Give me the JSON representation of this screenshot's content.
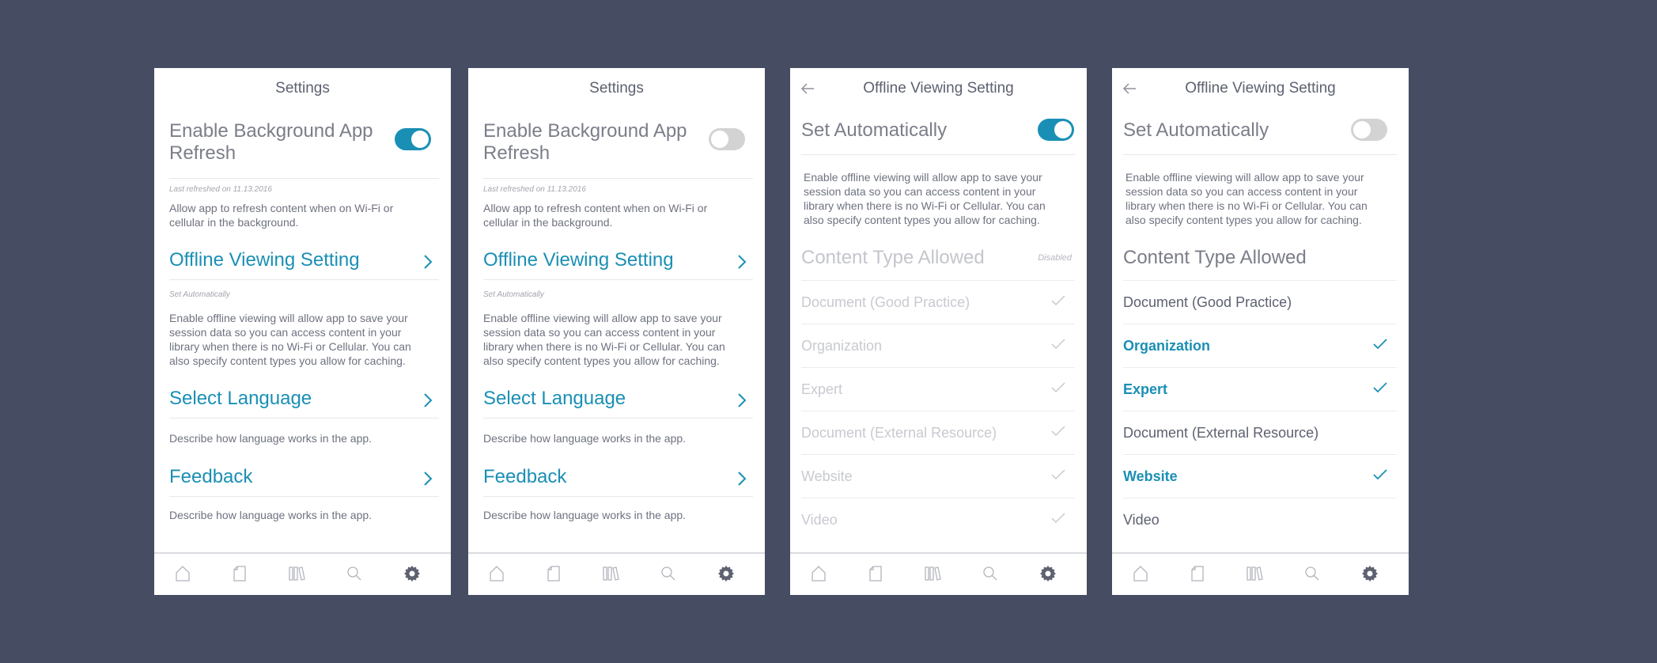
{
  "colors": {
    "background": "#464c61",
    "accent": "#1a8fb5",
    "text": "#7b7e89",
    "muted": "#c8cad0"
  },
  "tabbar": {
    "icons": [
      "home-icon",
      "document-icon",
      "library-icon",
      "search-icon",
      "gear-icon"
    ],
    "active": "gear-icon"
  },
  "screens": [
    {
      "title": "Settings",
      "bg_refresh": {
        "label": "Enable Background App Refresh",
        "enabled": true
      },
      "last_refreshed": "Last refreshed on 11.13.2016",
      "refresh_desc": "Allow app to refresh content when on Wi-Fi or cellular in the background.",
      "offline_link": "Offline Viewing Setting",
      "offline_note": "Set Automatically",
      "offline_desc": "Enable offline viewing will allow app to save your session data so you can access content in your library when there is no Wi-Fi or Cellular. You can also specify content types you allow for caching.",
      "language_link": "Select Language",
      "language_desc": "Describe how language works in the app.",
      "feedback_link": "Feedback",
      "feedback_desc": "Describe how language works in the app."
    },
    {
      "title": "Settings",
      "bg_refresh": {
        "label": "Enable Background App Refresh",
        "enabled": false
      },
      "last_refreshed": "Last refreshed on 11.13.2016",
      "refresh_desc": "Allow app to refresh content when on Wi-Fi or cellular in the background.",
      "offline_link": "Offline Viewing Setting",
      "offline_note": "Set Automatically",
      "offline_desc": "Enable offline viewing will allow app to save your session data so you can access content in your library when there is no Wi-Fi or Cellular. You can also specify content types you allow for caching.",
      "language_link": "Select Language",
      "language_desc": "Describe how language works in the app.",
      "feedback_link": "Feedback",
      "feedback_desc": "Describe how language works in the app."
    },
    {
      "title": "Offline Viewing Setting",
      "set_auto": {
        "label": "Set Automatically",
        "enabled": true
      },
      "desc": "Enable offline viewing will allow app to save your session data so you can access content in your library when there is no Wi-Fi or Cellular. You can also specify content types you allow for caching.",
      "content_header": "Content Type Allowed",
      "disabled_tag": "Disabled",
      "content_types": [
        {
          "label": "Document (Good Practice)",
          "checked": true
        },
        {
          "label": "Organization",
          "checked": true
        },
        {
          "label": "Expert",
          "checked": true
        },
        {
          "label": "Document (External Resource)",
          "checked": true
        },
        {
          "label": "Website",
          "checked": true
        },
        {
          "label": "Video",
          "checked": true
        }
      ]
    },
    {
      "title": "Offline Viewing Setting",
      "set_auto": {
        "label": "Set Automatically",
        "enabled": false
      },
      "desc": "Enable offline viewing will allow app to save your session data so you can access content in your library when there is no Wi-Fi or Cellular. You can also specify content types you allow for caching.",
      "content_header": "Content Type Allowed",
      "content_types": [
        {
          "label": "Document (Good Practice)",
          "checked": false
        },
        {
          "label": "Organization",
          "checked": true
        },
        {
          "label": "Expert",
          "checked": true
        },
        {
          "label": "Document (External Resource)",
          "checked": false
        },
        {
          "label": "Website",
          "checked": true
        },
        {
          "label": "Video",
          "checked": false
        }
      ]
    }
  ]
}
